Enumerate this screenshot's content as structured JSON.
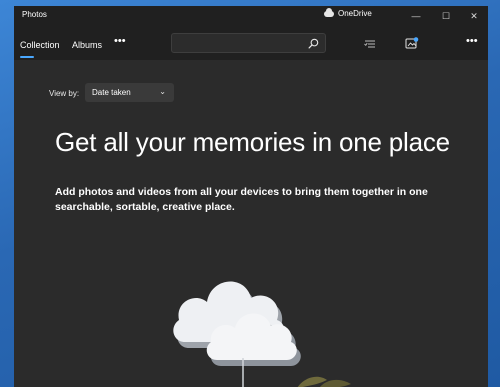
{
  "window": {
    "title": "Photos",
    "onedrive_label": "OneDrive",
    "controls": {
      "minimize": "—",
      "maximize": "☐",
      "close": "✕"
    }
  },
  "nav": {
    "tabs": [
      {
        "label": "Collection",
        "selected": true
      },
      {
        "label": "Albums",
        "selected": false
      }
    ],
    "more": "•••"
  },
  "search": {
    "value": "",
    "placeholder": ""
  },
  "toolbar": {
    "icons": [
      "select-icon",
      "import-icon",
      "more-options-icon"
    ],
    "more": "•••"
  },
  "view_by": {
    "label": "View by:",
    "selected": "Date taken"
  },
  "empty_state": {
    "headline": "Get all your memories in one place",
    "description": "Add photos and videos from all your devices to bring them together in one searchable, sortable, creative place."
  },
  "colors": {
    "accent": "#4aa8ff",
    "window_bg": "#2b2b2b",
    "chrome_bg": "#202020"
  }
}
